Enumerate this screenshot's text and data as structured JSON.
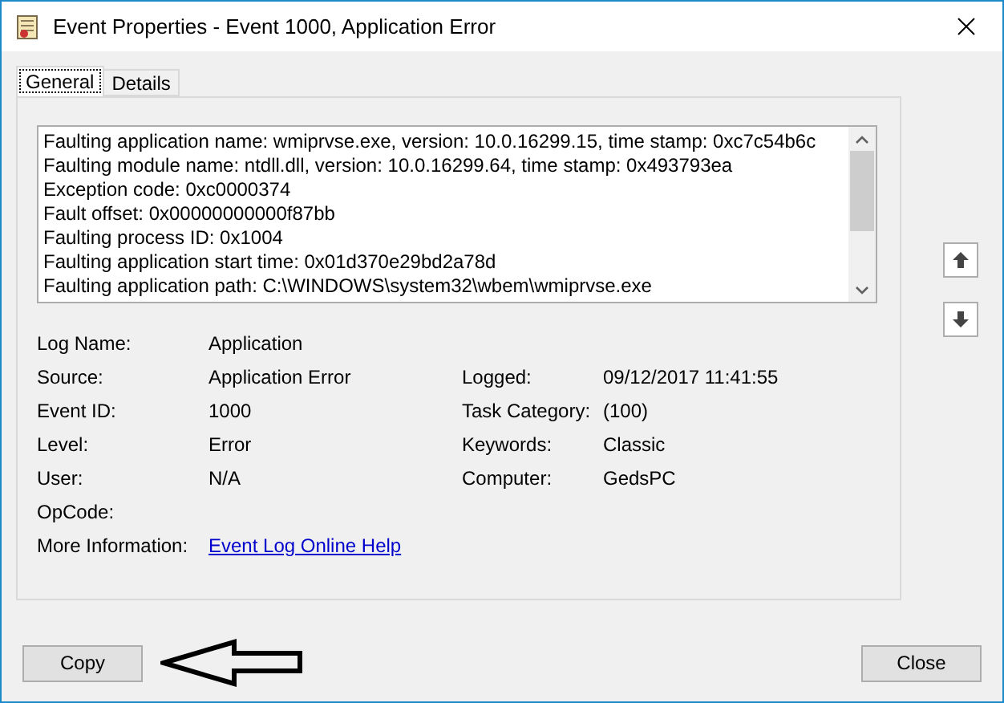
{
  "window": {
    "title": "Event Properties - Event 1000, Application Error"
  },
  "tabs": [
    {
      "label": "General",
      "selected": true
    },
    {
      "label": "Details",
      "selected": false
    }
  ],
  "description": [
    "Faulting application name: wmiprvse.exe, version: 10.0.16299.15, time stamp: 0xc7c54b6c",
    "Faulting module name: ntdll.dll, version: 10.0.16299.64, time stamp: 0x493793ea",
    "Exception code: 0xc0000374",
    "Fault offset: 0x00000000000f87bb",
    "Faulting process ID: 0x1004",
    "Faulting application start time: 0x01d370e29bd2a78d",
    "Faulting application path: C:\\WINDOWS\\system32\\wbem\\wmiprvse.exe"
  ],
  "fields": [
    {
      "label": "Log Name:",
      "value": "Application"
    },
    {
      "label": "Source:",
      "value": "Application Error",
      "label2": "Logged:",
      "value2": "09/12/2017 11:41:55"
    },
    {
      "label": "Event ID:",
      "value": "1000",
      "label2": "Task Category:",
      "value2": "(100)"
    },
    {
      "label": "Level:",
      "value": "Error",
      "label2": "Keywords:",
      "value2": "Classic"
    },
    {
      "label": "User:",
      "value": "N/A",
      "label2": "Computer:",
      "value2": "GedsPC"
    },
    {
      "label": "OpCode:"
    },
    {
      "label": "More Information:",
      "link": "Event Log Online Help"
    }
  ],
  "buttons": {
    "copy": "Copy",
    "close": "Close"
  }
}
